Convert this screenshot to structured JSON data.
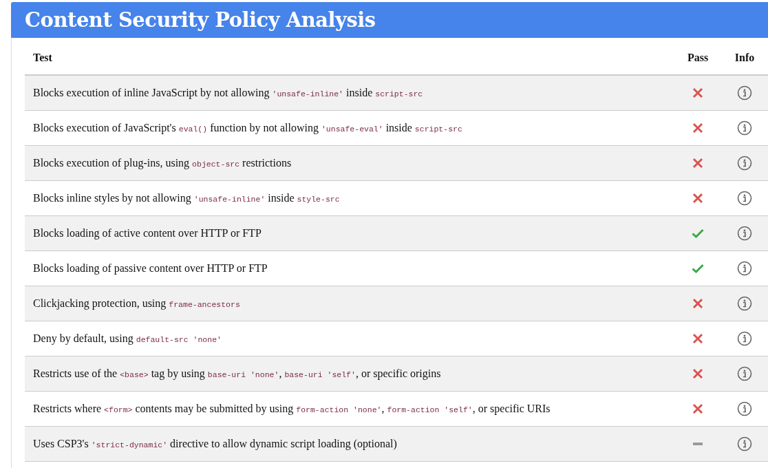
{
  "title": "Content Security Policy Analysis",
  "columns": [
    "Test",
    "Pass",
    "Info"
  ],
  "rows": [
    {
      "kind": "fail",
      "test": [
        {
          "kind": "text",
          "text": "Blocks execution of inline JavaScript by not allowing "
        },
        {
          "kind": "code",
          "text": "'unsafe-inline'"
        },
        {
          "kind": "text",
          "text": " inside "
        },
        {
          "kind": "code",
          "text": "script-src"
        }
      ]
    },
    {
      "kind": "fail",
      "test": [
        {
          "kind": "text",
          "text": "Blocks execution of JavaScript's "
        },
        {
          "kind": "code",
          "text": "eval()"
        },
        {
          "kind": "text",
          "text": " function by not allowing "
        },
        {
          "kind": "code",
          "text": "'unsafe-eval'"
        },
        {
          "kind": "text",
          "text": " inside "
        },
        {
          "kind": "code",
          "text": "script-src"
        }
      ]
    },
    {
      "kind": "fail",
      "test": [
        {
          "kind": "text",
          "text": "Blocks execution of plug-ins, using "
        },
        {
          "kind": "code",
          "text": "object-src"
        },
        {
          "kind": "text",
          "text": " restrictions"
        }
      ]
    },
    {
      "kind": "fail",
      "test": [
        {
          "kind": "text",
          "text": "Blocks inline styles by not allowing "
        },
        {
          "kind": "code",
          "text": "'unsafe-inline'"
        },
        {
          "kind": "text",
          "text": " inside "
        },
        {
          "kind": "code",
          "text": "style-src"
        }
      ]
    },
    {
      "kind": "pass",
      "test": [
        {
          "kind": "text",
          "text": "Blocks loading of active content over HTTP or FTP"
        }
      ]
    },
    {
      "kind": "pass",
      "test": [
        {
          "kind": "text",
          "text": "Blocks loading of passive content over HTTP or FTP"
        }
      ]
    },
    {
      "kind": "fail",
      "test": [
        {
          "kind": "text",
          "text": "Clickjacking protection, using "
        },
        {
          "kind": "code",
          "text": "frame-ancestors"
        }
      ]
    },
    {
      "kind": "fail",
      "test": [
        {
          "kind": "text",
          "text": "Deny by default, using "
        },
        {
          "kind": "code",
          "text": "default-src 'none'"
        }
      ]
    },
    {
      "kind": "fail",
      "test": [
        {
          "kind": "text",
          "text": "Restricts use of the "
        },
        {
          "kind": "code",
          "text": "<base>"
        },
        {
          "kind": "text",
          "text": " tag by using "
        },
        {
          "kind": "code",
          "text": "base-uri 'none'"
        },
        {
          "kind": "text",
          "text": ", "
        },
        {
          "kind": "code",
          "text": "base-uri 'self'"
        },
        {
          "kind": "text",
          "text": ", or specific origins"
        }
      ]
    },
    {
      "kind": "fail",
      "test": [
        {
          "kind": "text",
          "text": "Restricts where "
        },
        {
          "kind": "code",
          "text": "<form>"
        },
        {
          "kind": "text",
          "text": " contents may be submitted by using "
        },
        {
          "kind": "code",
          "text": "form-action 'none'"
        },
        {
          "kind": "text",
          "text": ", "
        },
        {
          "kind": "code",
          "text": "form-action 'self'"
        },
        {
          "kind": "text",
          "text": ", or specific URIs"
        }
      ]
    },
    {
      "kind": "neutral",
      "test": [
        {
          "kind": "text",
          "text": "Uses CSP3's "
        },
        {
          "kind": "code",
          "text": "'strict-dynamic'"
        },
        {
          "kind": "text",
          "text": " directive to allow dynamic script loading (optional)"
        }
      ]
    }
  ]
}
